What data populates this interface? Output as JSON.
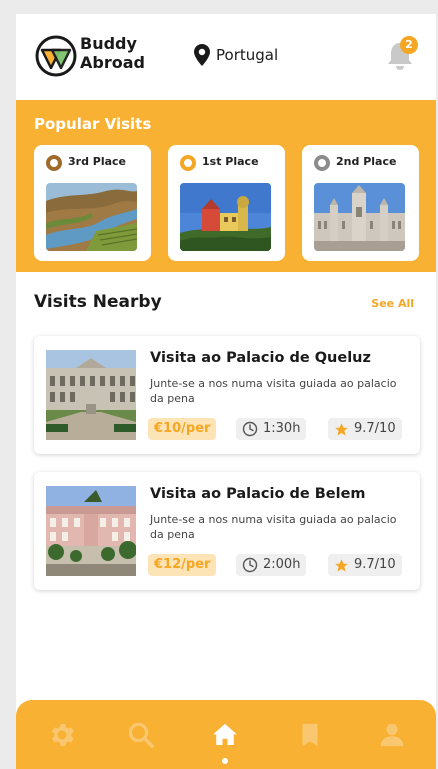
{
  "header": {
    "brand_line1": "Buddy",
    "brand_line2": "Abroad",
    "location": "Portugal",
    "notification_count": "2"
  },
  "popular": {
    "title": "Popular Visits",
    "cards": [
      {
        "label": "3rd Place",
        "ring_color": "#a06a2c"
      },
      {
        "label": "1st Place",
        "ring_color": "#f5a623"
      },
      {
        "label": "2nd Place",
        "ring_color": "#8c8c8c"
      }
    ]
  },
  "nearby": {
    "title": "Visits Nearby",
    "see_all": "See All",
    "visits": [
      {
        "title": "Visita ao Palacio de Queluz",
        "description": "Junte-se a nos numa visita guiada ao palacio da pena",
        "price": "€10/per",
        "duration": "1:30h",
        "rating": "9.7/10"
      },
      {
        "title": "Visita ao Palacio de Belem",
        "description": "Junte-se a nos numa visita guiada ao palacio da pena",
        "price": "€12/per",
        "duration": "2:00h",
        "rating": "9.7/10"
      }
    ]
  },
  "nav": {
    "items": [
      "gear-icon",
      "search-icon",
      "home-icon",
      "bookmark-icon",
      "user-icon"
    ],
    "active": "home-icon"
  },
  "colors": {
    "accent": "#f8b132",
    "accent_dark": "#f5a623",
    "nav_icon_inactive": "#f9c76f"
  }
}
